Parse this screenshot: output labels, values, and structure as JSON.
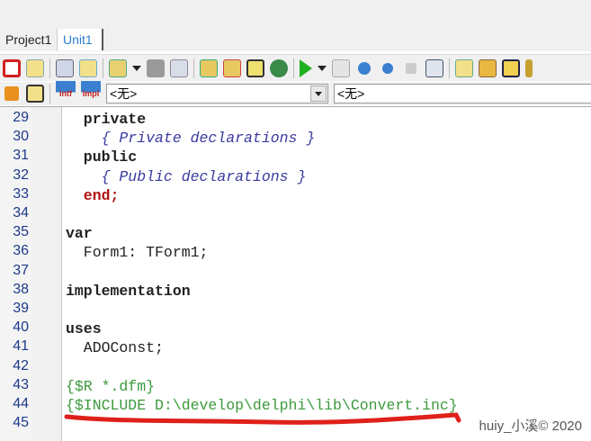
{
  "tabs": [
    {
      "label": "Project1"
    },
    {
      "label": "Unit1",
      "active": true
    }
  ],
  "toolbar": {
    "combo1": "<无>",
    "combo2": "<无>",
    "intf_label": "Intf",
    "impl_label": "Impl"
  },
  "editor": {
    "lines": [
      {
        "n": "29",
        "text": "  private",
        "style": "kw"
      },
      {
        "n": "30",
        "text": "    { Private declarations }",
        "style": "cm"
      },
      {
        "n": "31",
        "text": "  public",
        "style": "kw"
      },
      {
        "n": "32",
        "text": "    { Public declarations }",
        "style": "cm"
      },
      {
        "n": "33",
        "text": "  end;",
        "style": "red"
      },
      {
        "n": "34",
        "text": "",
        "style": ""
      },
      {
        "n": "35",
        "text": "var",
        "style": "kw"
      },
      {
        "n": "36",
        "text": "  Form1: TForm1;",
        "style": ""
      },
      {
        "n": "37",
        "text": "",
        "style": ""
      },
      {
        "n": "38",
        "text": "implementation",
        "style": "kw"
      },
      {
        "n": "39",
        "text": "",
        "style": ""
      },
      {
        "n": "40",
        "text": "uses",
        "style": "kw"
      },
      {
        "n": "41",
        "text": "  ADOConst;",
        "style": ""
      },
      {
        "n": "42",
        "text": "",
        "style": ""
      },
      {
        "n": "43",
        "text": "{$R *.dfm}",
        "style": "dir"
      },
      {
        "n": "44",
        "text": "{$INCLUDE D:\\develop\\delphi\\lib\\Convert.inc}",
        "style": "dir"
      },
      {
        "n": "45",
        "text": "",
        "style": ""
      }
    ]
  },
  "watermark": "huiy_小溪© 2020",
  "colors": {
    "annotation": "#e0201a",
    "directive": "#3c9a3c",
    "comment": "#3a3aa0"
  }
}
